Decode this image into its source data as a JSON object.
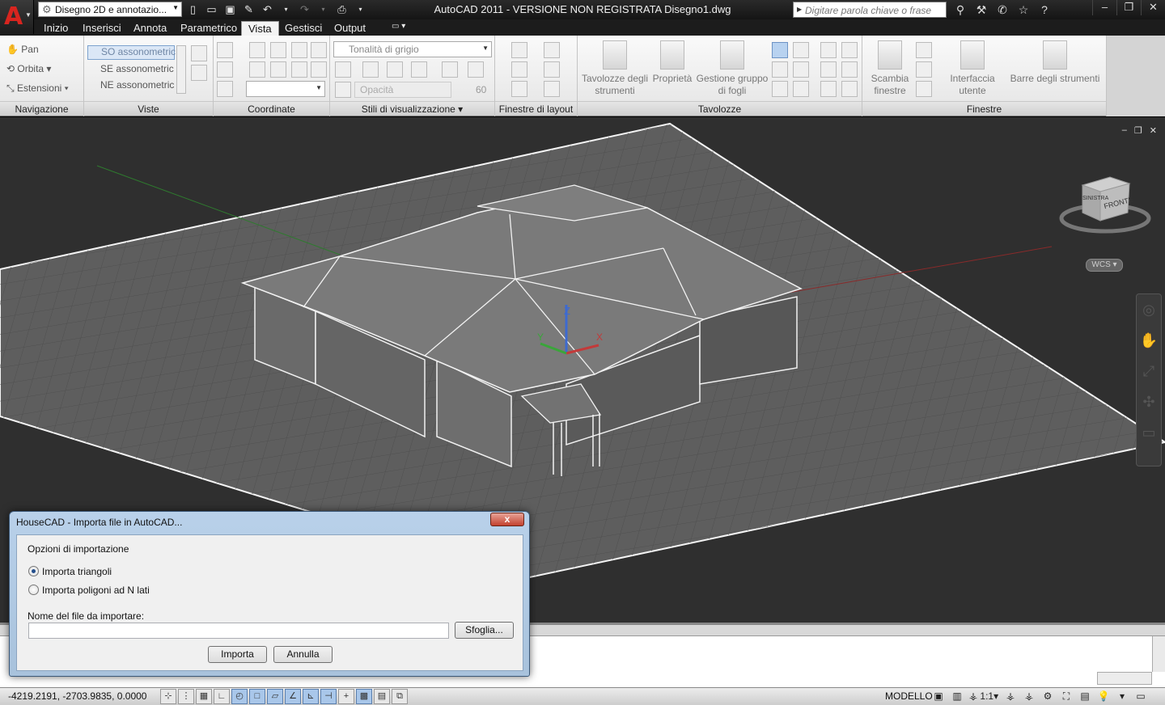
{
  "app": {
    "title": "AutoCAD 2011 - VERSIONE NON REGISTRATA    Disegno1.dwg",
    "logo_letter": "A",
    "workspace": "Disegno 2D e annotazio...",
    "search_placeholder": "Digitare parola chiave o frase"
  },
  "ribbon_tabs": [
    {
      "label": "Inizio"
    },
    {
      "label": "Inserisci"
    },
    {
      "label": "Annota"
    },
    {
      "label": "Parametrico"
    },
    {
      "label": "Vista"
    },
    {
      "label": "Gestisci"
    },
    {
      "label": "Output"
    }
  ],
  "active_tab": "Vista",
  "panels": {
    "navigazione": {
      "title": "Navigazione",
      "items": [
        "Pan",
        "Orbita",
        "Estensioni"
      ]
    },
    "viste": {
      "title": "Viste",
      "items": [
        "SO assonometric",
        "SE assonometric",
        "NE assonometric"
      ]
    },
    "coordinate": {
      "title": "Coordinate"
    },
    "stili": {
      "title": "Stili di visualizzazione",
      "visual_style": "Tonalità di grigio",
      "opacity_label": "Opacità",
      "opacity_value": "60"
    },
    "finestre_layout": {
      "title": "Finestre di layout"
    },
    "tavolozze": {
      "title": "Tavolozze",
      "buttons": [
        "Tavolozze degli strumenti",
        "Proprietà",
        "Gestione gruppo di fogli"
      ]
    },
    "finestre": {
      "title": "Finestre",
      "buttons": [
        "Scambia finestre",
        "Interfaccia utente",
        "Barre degli strumenti"
      ]
    }
  },
  "viewcube": {
    "face_front": "FRONTE",
    "face_side": "SINISTRA",
    "wcs": "WCS"
  },
  "ucs": {
    "x": "X",
    "y": "Y",
    "z": "Z"
  },
  "statusbar": {
    "coords": "-4219.2191, -2703.9835, 0.0000",
    "model": "MODELLO",
    "scale": "1:1"
  },
  "dialog": {
    "title": "HouseCAD - Importa file in AutoCAD...",
    "close": "x",
    "options_label": "Opzioni di importazione",
    "option1": "Importa triangoli",
    "option2": "Importa poligoni ad N lati",
    "selected_option": "Importa triangoli",
    "file_label": "Nome del file da importare:",
    "file_value": "",
    "browse": "Sfoglia...",
    "import": "Importa",
    "cancel": "Annulla"
  },
  "colors": {
    "viewport_bg": "#2f2f2f",
    "grid_plane": "#5e5e5e",
    "model_wall": "#6d6d6d",
    "accent_red": "#d8251f"
  }
}
